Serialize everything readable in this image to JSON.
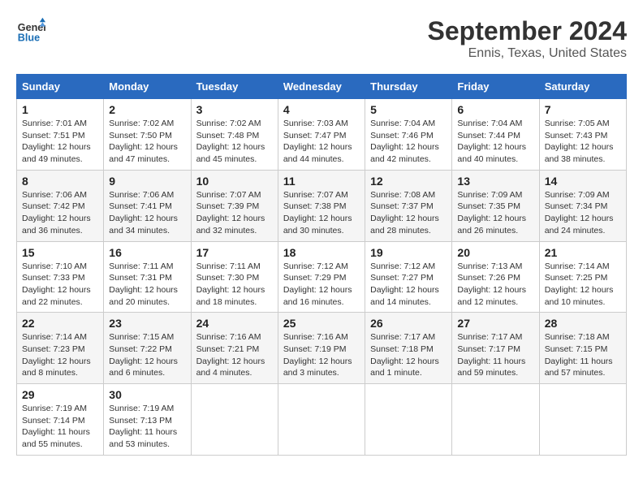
{
  "header": {
    "logo_line1": "General",
    "logo_line2": "Blue",
    "month": "September 2024",
    "location": "Ennis, Texas, United States"
  },
  "weekdays": [
    "Sunday",
    "Monday",
    "Tuesday",
    "Wednesday",
    "Thursday",
    "Friday",
    "Saturday"
  ],
  "weeks": [
    [
      {
        "day": "1",
        "sunrise": "7:01 AM",
        "sunset": "7:51 PM",
        "daylight": "12 hours and 49 minutes."
      },
      {
        "day": "2",
        "sunrise": "7:02 AM",
        "sunset": "7:50 PM",
        "daylight": "12 hours and 47 minutes."
      },
      {
        "day": "3",
        "sunrise": "7:02 AM",
        "sunset": "7:48 PM",
        "daylight": "12 hours and 45 minutes."
      },
      {
        "day": "4",
        "sunrise": "7:03 AM",
        "sunset": "7:47 PM",
        "daylight": "12 hours and 44 minutes."
      },
      {
        "day": "5",
        "sunrise": "7:04 AM",
        "sunset": "7:46 PM",
        "daylight": "12 hours and 42 minutes."
      },
      {
        "day": "6",
        "sunrise": "7:04 AM",
        "sunset": "7:44 PM",
        "daylight": "12 hours and 40 minutes."
      },
      {
        "day": "7",
        "sunrise": "7:05 AM",
        "sunset": "7:43 PM",
        "daylight": "12 hours and 38 minutes."
      }
    ],
    [
      {
        "day": "8",
        "sunrise": "7:06 AM",
        "sunset": "7:42 PM",
        "daylight": "12 hours and 36 minutes."
      },
      {
        "day": "9",
        "sunrise": "7:06 AM",
        "sunset": "7:41 PM",
        "daylight": "12 hours and 34 minutes."
      },
      {
        "day": "10",
        "sunrise": "7:07 AM",
        "sunset": "7:39 PM",
        "daylight": "12 hours and 32 minutes."
      },
      {
        "day": "11",
        "sunrise": "7:07 AM",
        "sunset": "7:38 PM",
        "daylight": "12 hours and 30 minutes."
      },
      {
        "day": "12",
        "sunrise": "7:08 AM",
        "sunset": "7:37 PM",
        "daylight": "12 hours and 28 minutes."
      },
      {
        "day": "13",
        "sunrise": "7:09 AM",
        "sunset": "7:35 PM",
        "daylight": "12 hours and 26 minutes."
      },
      {
        "day": "14",
        "sunrise": "7:09 AM",
        "sunset": "7:34 PM",
        "daylight": "12 hours and 24 minutes."
      }
    ],
    [
      {
        "day": "15",
        "sunrise": "7:10 AM",
        "sunset": "7:33 PM",
        "daylight": "12 hours and 22 minutes."
      },
      {
        "day": "16",
        "sunrise": "7:11 AM",
        "sunset": "7:31 PM",
        "daylight": "12 hours and 20 minutes."
      },
      {
        "day": "17",
        "sunrise": "7:11 AM",
        "sunset": "7:30 PM",
        "daylight": "12 hours and 18 minutes."
      },
      {
        "day": "18",
        "sunrise": "7:12 AM",
        "sunset": "7:29 PM",
        "daylight": "12 hours and 16 minutes."
      },
      {
        "day": "19",
        "sunrise": "7:12 AM",
        "sunset": "7:27 PM",
        "daylight": "12 hours and 14 minutes."
      },
      {
        "day": "20",
        "sunrise": "7:13 AM",
        "sunset": "7:26 PM",
        "daylight": "12 hours and 12 minutes."
      },
      {
        "day": "21",
        "sunrise": "7:14 AM",
        "sunset": "7:25 PM",
        "daylight": "12 hours and 10 minutes."
      }
    ],
    [
      {
        "day": "22",
        "sunrise": "7:14 AM",
        "sunset": "7:23 PM",
        "daylight": "12 hours and 8 minutes."
      },
      {
        "day": "23",
        "sunrise": "7:15 AM",
        "sunset": "7:22 PM",
        "daylight": "12 hours and 6 minutes."
      },
      {
        "day": "24",
        "sunrise": "7:16 AM",
        "sunset": "7:21 PM",
        "daylight": "12 hours and 4 minutes."
      },
      {
        "day": "25",
        "sunrise": "7:16 AM",
        "sunset": "7:19 PM",
        "daylight": "12 hours and 3 minutes."
      },
      {
        "day": "26",
        "sunrise": "7:17 AM",
        "sunset": "7:18 PM",
        "daylight": "12 hours and 1 minute."
      },
      {
        "day": "27",
        "sunrise": "7:17 AM",
        "sunset": "7:17 PM",
        "daylight": "11 hours and 59 minutes."
      },
      {
        "day": "28",
        "sunrise": "7:18 AM",
        "sunset": "7:15 PM",
        "daylight": "11 hours and 57 minutes."
      }
    ],
    [
      {
        "day": "29",
        "sunrise": "7:19 AM",
        "sunset": "7:14 PM",
        "daylight": "11 hours and 55 minutes."
      },
      {
        "day": "30",
        "sunrise": "7:19 AM",
        "sunset": "7:13 PM",
        "daylight": "11 hours and 53 minutes."
      },
      null,
      null,
      null,
      null,
      null
    ]
  ]
}
